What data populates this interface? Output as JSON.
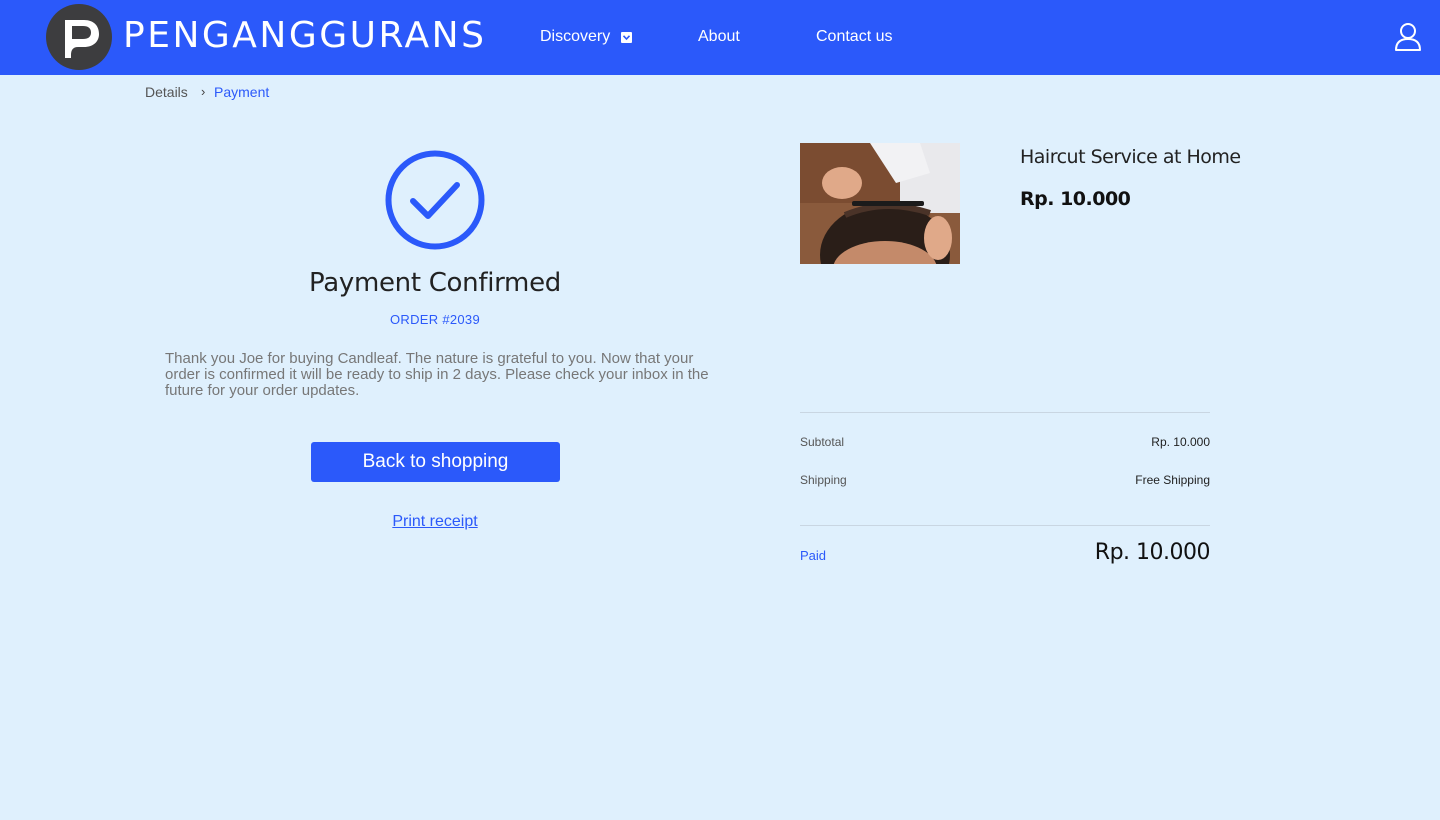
{
  "header": {
    "brand": "PENGANGGURANS",
    "nav": [
      {
        "label": "Discovery"
      },
      {
        "label": "About"
      },
      {
        "label": "Contact us"
      }
    ]
  },
  "breadcrumb": {
    "items": [
      "Details",
      "Payment"
    ],
    "separator": "›"
  },
  "confirmation": {
    "title": "Payment Confirmed",
    "order": "ORDER #2039",
    "message": "Thank you Joe for buying Candleaf. The nature is grateful to you. Now that your order is confirmed it will be ready to ship in 2 days. Please check your inbox in the future for your order updates.",
    "back_button": "Back to shopping",
    "print_link": "Print receipt"
  },
  "summary": {
    "product_name": "Haircut Service at Home",
    "product_price": "Rp. 10.000",
    "subtotal_label": "Subtotal",
    "subtotal_value": "Rp. 10.000",
    "shipping_label": "Shipping",
    "shipping_value": "Free Shipping",
    "paid_label": "Paid",
    "paid_value": "Rp. 10.000"
  },
  "colors": {
    "accent": "#2b59fa",
    "background": "#dff0fd",
    "logo": "#3d3d3f"
  },
  "icons": [
    "logo-icon",
    "chevron-down-icon",
    "user-icon",
    "chevron-right-icon",
    "check-circle-icon"
  ]
}
